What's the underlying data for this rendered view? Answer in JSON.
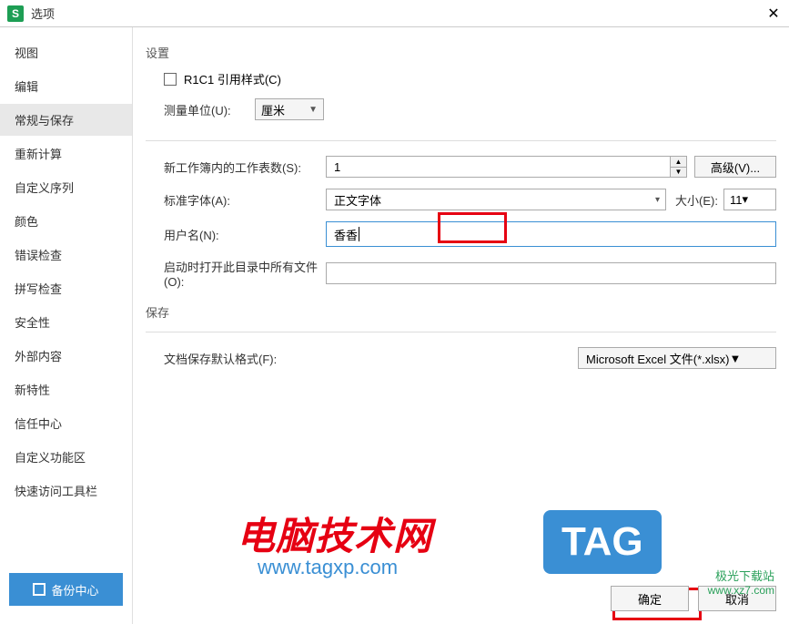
{
  "window": {
    "title": "选项",
    "app_icon_letter": "S"
  },
  "sidebar": {
    "items": [
      {
        "label": "视图"
      },
      {
        "label": "编辑"
      },
      {
        "label": "常规与保存"
      },
      {
        "label": "重新计算"
      },
      {
        "label": "自定义序列"
      },
      {
        "label": "颜色"
      },
      {
        "label": "错误检查"
      },
      {
        "label": "拼写检查"
      },
      {
        "label": "安全性"
      },
      {
        "label": "外部内容"
      },
      {
        "label": "新特性"
      },
      {
        "label": "信任中心"
      },
      {
        "label": "自定义功能区"
      },
      {
        "label": "快速访问工具栏"
      }
    ],
    "backup_label": "备份中心"
  },
  "settings": {
    "section_label": "设置",
    "r1c1_label": "R1C1 引用样式(C)",
    "unit_label": "测量单位(U):",
    "unit_value": "厘米",
    "sheets_label": "新工作簿内的工作表数(S):",
    "sheets_value": "1",
    "advanced_label": "高级(V)...",
    "font_label": "标准字体(A):",
    "font_value": "正文字体",
    "size_label": "大小(E):",
    "size_value": "11",
    "username_label": "用户名(N):",
    "username_value": "香香",
    "startup_label": "启动时打开此目录中所有文件(O):"
  },
  "save": {
    "section_label": "保存",
    "format_label": "文档保存默认格式(F):",
    "format_value": "Microsoft Excel 文件(*.xlsx)"
  },
  "footer": {
    "ok": "确定",
    "cancel": "取消"
  },
  "watermarks": {
    "main": "电脑技术网",
    "sub": "www.tagxp.com",
    "tag": "TAG",
    "jiguang_title": "极光下载站",
    "jiguang_url": "www.xz7.com"
  }
}
